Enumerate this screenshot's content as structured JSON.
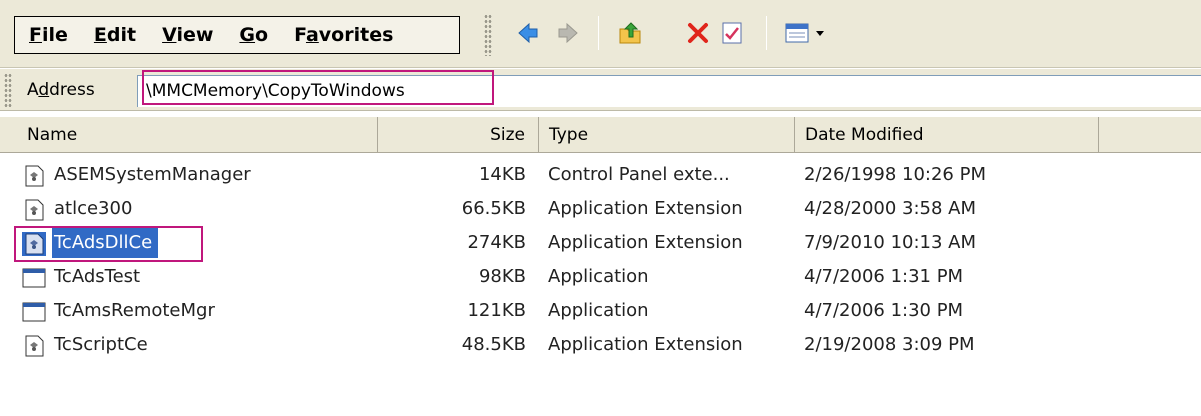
{
  "menu": {
    "items": [
      {
        "accel": "F",
        "rest": "ile"
      },
      {
        "accel": "E",
        "rest": "dit"
      },
      {
        "accel": "V",
        "rest": "iew"
      },
      {
        "accel": "G",
        "rest": "o"
      },
      {
        "pre": "F",
        "accel": "a",
        "rest": "vorites"
      }
    ]
  },
  "toolbar": {
    "buttons": [
      "back-icon",
      "forward-icon",
      "up-folder-icon",
      "delete-icon",
      "properties-icon",
      "views-icon"
    ]
  },
  "address": {
    "label_pre": "A",
    "label_accel": "d",
    "label_post": "dress",
    "value": "\\MMCMemory\\CopyToWindows"
  },
  "columns": {
    "name": "Name",
    "size": "Size",
    "type": "Type",
    "date": "Date Modified"
  },
  "files": [
    {
      "name": "ASEMSystemManager",
      "size": "14KB",
      "type": "Control Panel exte...",
      "date": "2/26/1998 10:26 PM",
      "icon": "dll-icon"
    },
    {
      "name": "atlce300",
      "size": "66.5KB",
      "type": "Application Extension",
      "date": "4/28/2000 3:58 AM",
      "icon": "dll-icon"
    },
    {
      "name": "TcAdsDllCe",
      "size": "274KB",
      "type": "Application Extension",
      "date": "7/9/2010 10:13 AM",
      "icon": "dll-icon",
      "selected": true
    },
    {
      "name": "TcAdsTest",
      "size": "98KB",
      "type": "Application",
      "date": "4/7/2006 1:31 PM",
      "icon": "app-icon"
    },
    {
      "name": "TcAmsRemoteMgr",
      "size": "121KB",
      "type": "Application",
      "date": "4/7/2006 1:30 PM",
      "icon": "app-icon"
    },
    {
      "name": "TcScriptCe",
      "size": "48.5KB",
      "type": "Application Extension",
      "date": "2/19/2008 3:09 PM",
      "icon": "dll-icon"
    }
  ],
  "colors": {
    "selection": "#316ac5",
    "highlight_box": "#c0177c",
    "chrome": "#ece9d8"
  }
}
